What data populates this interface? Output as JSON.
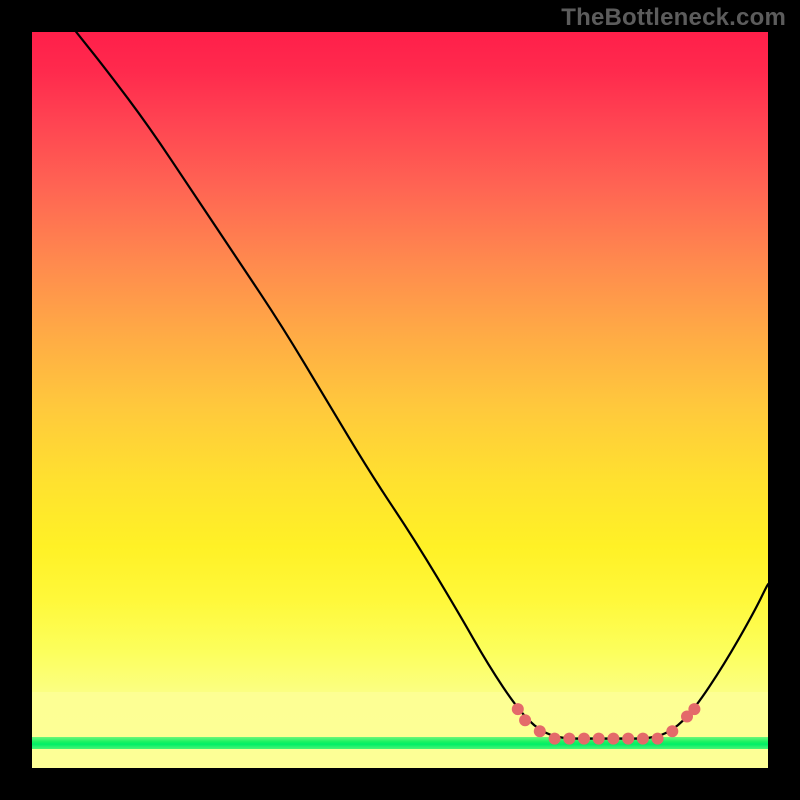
{
  "watermark": "TheBottleneck.com",
  "colors": {
    "background": "#000000",
    "gradient_top": "#ff1f4a",
    "gradient_bottom": "#fbff82",
    "green_strip": "#00ef66",
    "curve": "#000000",
    "marker": "#e46a6a"
  },
  "chart_data": {
    "type": "line",
    "title": "",
    "xlabel": "",
    "ylabel": "",
    "xlim": [
      0,
      100
    ],
    "ylim": [
      0,
      100
    ],
    "grid": false,
    "legend": false,
    "curve": [
      {
        "x": 6,
        "y": 100
      },
      {
        "x": 10,
        "y": 95
      },
      {
        "x": 16,
        "y": 87
      },
      {
        "x": 22,
        "y": 78
      },
      {
        "x": 28,
        "y": 69
      },
      {
        "x": 34,
        "y": 60
      },
      {
        "x": 40,
        "y": 50
      },
      {
        "x": 46,
        "y": 40
      },
      {
        "x": 52,
        "y": 31
      },
      {
        "x": 58,
        "y": 21
      },
      {
        "x": 62,
        "y": 14
      },
      {
        "x": 66,
        "y": 8
      },
      {
        "x": 69,
        "y": 5
      },
      {
        "x": 72,
        "y": 4
      },
      {
        "x": 76,
        "y": 4
      },
      {
        "x": 80,
        "y": 4
      },
      {
        "x": 84,
        "y": 4
      },
      {
        "x": 87,
        "y": 5
      },
      {
        "x": 90,
        "y": 8
      },
      {
        "x": 94,
        "y": 14
      },
      {
        "x": 98,
        "y": 21
      },
      {
        "x": 100,
        "y": 25
      }
    ],
    "markers": [
      {
        "x": 66,
        "y": 8
      },
      {
        "x": 67,
        "y": 6.5
      },
      {
        "x": 69,
        "y": 5
      },
      {
        "x": 71,
        "y": 4
      },
      {
        "x": 73,
        "y": 4
      },
      {
        "x": 75,
        "y": 4
      },
      {
        "x": 77,
        "y": 4
      },
      {
        "x": 79,
        "y": 4
      },
      {
        "x": 81,
        "y": 4
      },
      {
        "x": 83,
        "y": 4
      },
      {
        "x": 85,
        "y": 4
      },
      {
        "x": 87,
        "y": 5
      },
      {
        "x": 89,
        "y": 7
      },
      {
        "x": 90,
        "y": 8
      }
    ]
  }
}
